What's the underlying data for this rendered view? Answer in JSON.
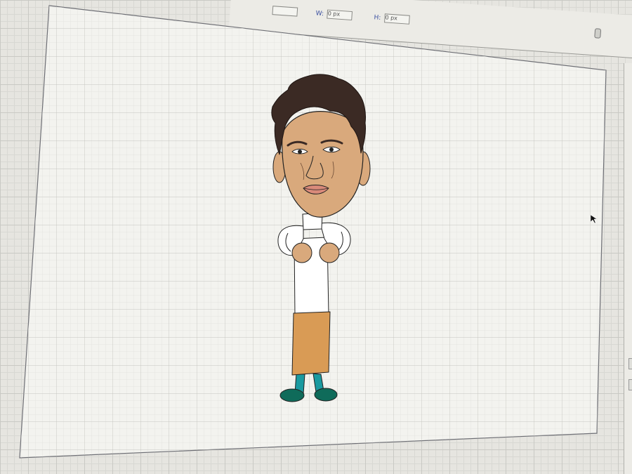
{
  "toolbar": {
    "w_label": "W:",
    "w_value": "0 px",
    "h_label": "H:",
    "h_value": "0 px"
  },
  "canvas": {
    "artboard_color": "#ffffff",
    "grid_color": "#c9c9c4"
  },
  "character": {
    "hair_color": "#3b2a24",
    "skin_color": "#d9a97c",
    "shirt_color": "#ffffff",
    "skirt_color": "#d99b55",
    "leg_color": "#1a9aa0",
    "shoe_color": "#0f6b5a",
    "outline_color": "#222222"
  },
  "icons": {
    "cursor": "mouse-pointer-icon",
    "lock": "lock-icon"
  }
}
